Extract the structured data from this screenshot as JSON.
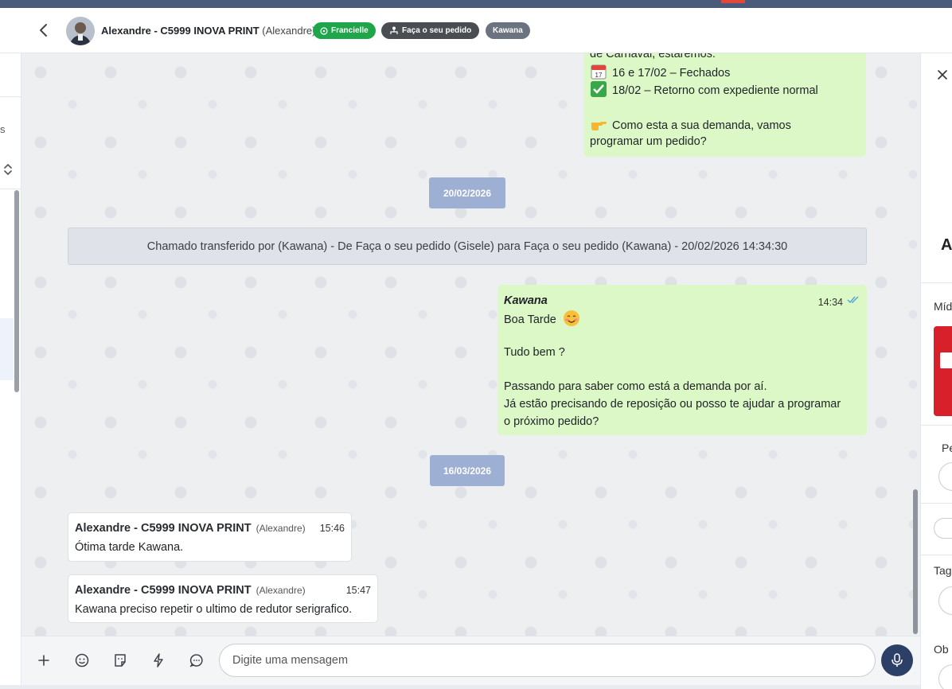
{
  "header": {
    "contact_name": "Alexandre - C5999 INOVA PRINT",
    "contact_nick": "(Alexandre)",
    "tags": {
      "whatsapp": "Francielle",
      "queue": "Faça o seu pedido",
      "agent": "Kawana"
    }
  },
  "left_rail": {
    "partial_letter": "s"
  },
  "messages": {
    "first_out": {
      "line1": "de Carnaval, estaremos:",
      "line2": "16 e 17/02 – Fechados",
      "line3": "18/02 – Retorno com expediente normal",
      "line4": "Como esta a sua demanda, vamos",
      "line5": "programar um pedido?"
    },
    "date1": "20/02/2026",
    "system_note": "Chamado transferido por (Kawana) - De Faça o seu pedido (Gisele) para Faça o seu pedido (Kawana) - 20/02/2026 14:34:30",
    "second_out": {
      "author": "Kawana",
      "time": "14:34",
      "line1": "Boa Tarde",
      "line2": "Tudo bem ?",
      "line3": "Passando para saber como está a demanda por aí.",
      "line4": "Já estão precisando de reposição ou posso te ajudar a programar",
      "line5": "o próximo pedido?"
    },
    "date2": "16/03/2026",
    "in1": {
      "name": "Alexandre - C5999 INOVA PRINT",
      "nick": "(Alexandre)",
      "time": "15:46",
      "text": "Ótima tarde Kawana."
    },
    "in2": {
      "name": "Alexandre - C5999 INOVA PRINT",
      "nick": "(Alexandre)",
      "time": "15:47",
      "text": "Kawana preciso repetir o ultimo de redutor serigrafico."
    }
  },
  "composer": {
    "placeholder": "Digite uma mensagem"
  },
  "right_panel": {
    "name_initial": "Al",
    "media_label": "Míd",
    "section_pe": "Pe",
    "section_tag": "Tag",
    "section_ob": "Ob"
  },
  "colors": {
    "outgoing_bubble": "#dcf8c6",
    "date_chip": "#9db0d3",
    "whatsapp_tag": "#1fa64a",
    "mic_button": "#2c3f66"
  }
}
